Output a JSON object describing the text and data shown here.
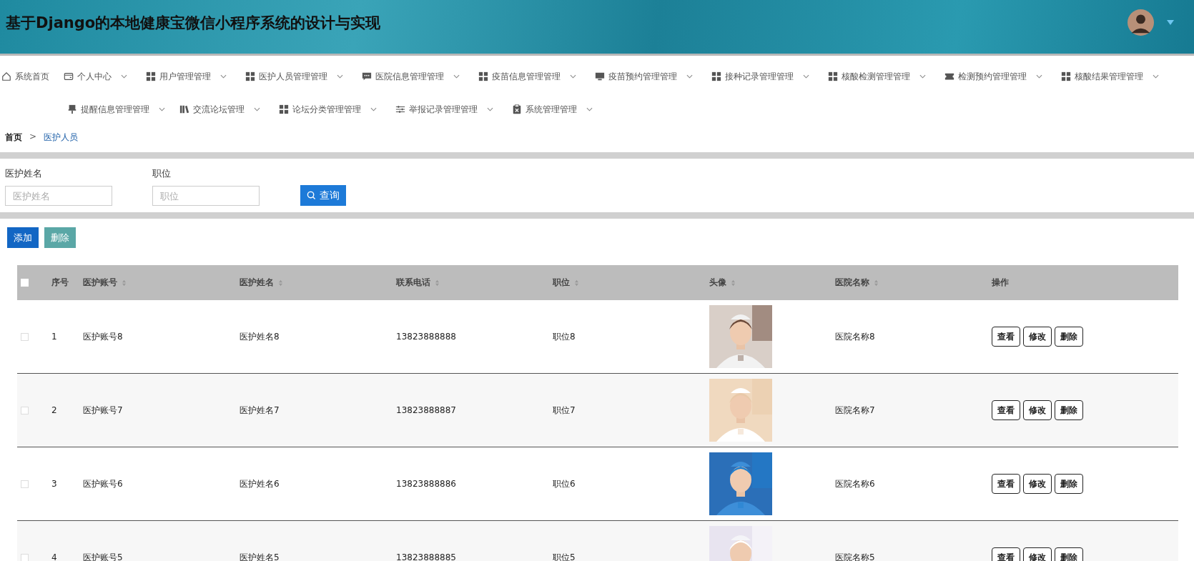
{
  "header": {
    "title": "基于Django的本地健康宝微信小程序系统的设计与实现"
  },
  "nav": [
    {
      "label": "系统首页",
      "has_menu": false
    },
    {
      "label": "个人中心",
      "has_menu": true
    },
    {
      "label": "用户管理管理",
      "has_menu": true
    },
    {
      "label": "医护人员管理管理",
      "has_menu": true
    },
    {
      "label": "医院信息管理管理",
      "has_menu": true
    },
    {
      "label": "疫苗信息管理管理",
      "has_menu": true
    },
    {
      "label": "疫苗预约管理管理",
      "has_menu": true
    },
    {
      "label": "接种记录管理管理",
      "has_menu": true
    },
    {
      "label": "核酸检测管理管理",
      "has_menu": true
    },
    {
      "label": "检测预约管理管理",
      "has_menu": true
    },
    {
      "label": "核酸结果管理管理",
      "has_menu": true
    },
    {
      "label": "提醒信息管理管理",
      "has_menu": true
    },
    {
      "label": "交流论坛管理",
      "has_menu": true
    },
    {
      "label": "论坛分类管理管理",
      "has_menu": true
    },
    {
      "label": "举报记录管理管理",
      "has_menu": true
    },
    {
      "label": "系统管理管理",
      "has_menu": true
    }
  ],
  "breadcrumb": [
    "首页",
    ">",
    "医护人员"
  ],
  "search": {
    "fields": [
      {
        "label": "医护姓名",
        "placeholder": "医护姓名"
      },
      {
        "label": "职位",
        "placeholder": "职位"
      }
    ],
    "button": "查询"
  },
  "actions": [
    {
      "label": "添加",
      "kind": "primary"
    },
    {
      "label": "删除",
      "kind": "muted"
    }
  ],
  "table": {
    "all_checked": false,
    "columns": [
      {
        "label": "序号",
        "sortable": false
      },
      {
        "label": "医护账号",
        "sortable": true
      },
      {
        "label": "医护姓名",
        "sortable": true
      },
      {
        "label": "联系电话",
        "sortable": true
      },
      {
        "label": "职位",
        "sortable": true
      },
      {
        "label": "头像",
        "sortable": true
      },
      {
        "label": "医院名称",
        "sortable": true
      },
      {
        "label": "操作",
        "sortable": false
      }
    ],
    "rows": [
      {
        "checked": false,
        "cells": [
          "1",
          "医护账号8",
          "医护姓名8",
          "13823888888",
          "职位8"
        ],
        "hospital": "医院名称8",
        "buttons": [
          "查看",
          "修改",
          "删除"
        ]
      },
      {
        "checked": false,
        "cells": [
          "2",
          "医护账号7",
          "医护姓名7",
          "13823888887",
          "职位7"
        ],
        "hospital": "医院名称7",
        "buttons": [
          "查看",
          "修改",
          "删除"
        ]
      },
      {
        "checked": false,
        "cells": [
          "3",
          "医护账号6",
          "医护姓名6",
          "13823888886",
          "职位6"
        ],
        "hospital": "医院名称6",
        "buttons": [
          "查看",
          "修改",
          "删除"
        ]
      },
      {
        "checked": false,
        "cells": [
          "4",
          "医护账号5",
          "医护姓名5",
          "13823888885",
          "职位5"
        ],
        "hospital": "医院名称5",
        "buttons": [
          "查看",
          "修改",
          "删除"
        ]
      }
    ]
  }
}
